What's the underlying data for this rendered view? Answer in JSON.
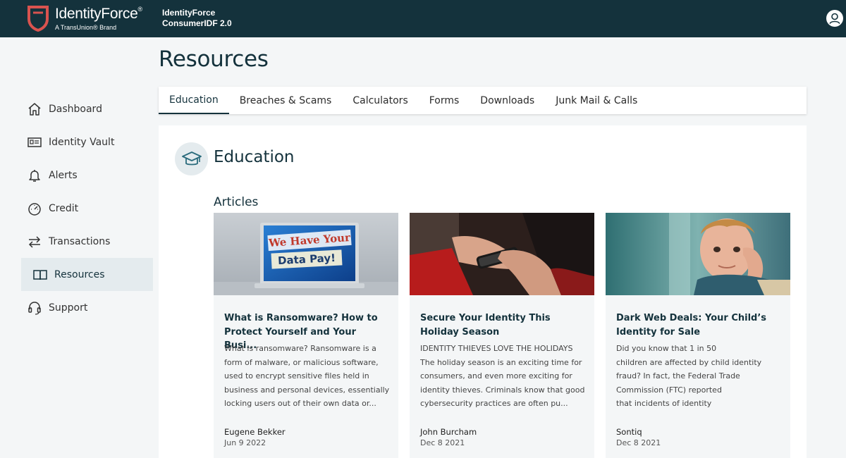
{
  "header": {
    "logo_brand": "IdentityForce",
    "logo_reg": "®",
    "logo_tagline": "A TransUnion® Brand",
    "product_line1": "IdentityForce",
    "product_line2": "ConsumerIDF 2.0",
    "brand_color": "#14323c",
    "accent_color": "#d9534f"
  },
  "sidebar": {
    "items": [
      {
        "label": "Dashboard",
        "icon": "home-icon"
      },
      {
        "label": "Identity Vault",
        "icon": "id-card-icon"
      },
      {
        "label": "Alerts",
        "icon": "bell-icon"
      },
      {
        "label": "Credit",
        "icon": "gauge-icon"
      },
      {
        "label": "Transactions",
        "icon": "arrows-icon"
      },
      {
        "label": "Resources",
        "icon": "book-icon",
        "active": true
      },
      {
        "label": "Support",
        "icon": "headset-icon"
      }
    ]
  },
  "page": {
    "title": "Resources"
  },
  "tabs": [
    {
      "label": "Education",
      "active": true
    },
    {
      "label": "Breaches & Scams"
    },
    {
      "label": "Calculators"
    },
    {
      "label": "Forms"
    },
    {
      "label": "Downloads"
    },
    {
      "label": "Junk Mail & Calls"
    }
  ],
  "section": {
    "title": "Education",
    "subtitle": "Articles"
  },
  "articles": [
    {
      "image_text_line1": "We Have Your",
      "image_text_line2": "Data Pay!",
      "title": "What is Ransomware? How to Protect Yourself and Your Busi...",
      "excerpt": "What is ransomware? Ransomware is a form of malware, or malicious software, used to encrypt sensitive files held in business and personal devices, essentially locking users out of their own data or...",
      "author": "Eugene Bekker",
      "date": "Jun 9 2022"
    },
    {
      "title": "Secure Your Identity This Holiday Season",
      "excerpt": "IDENTITY THIEVES LOVE THE HOLIDAYS\nThe holiday season is an exciting time for consumers, and even more exciting for identity thieves. Criminals know that good cybersecurity practices are often pu...",
      "author": "John Burcham",
      "date": "Dec 8 2021"
    },
    {
      "title": "Dark Web Deals: Your Child’s Identity for Sale",
      "excerpt": "Did you know that 1 in 50\nchildren are affected by child identity fraud? In fact, the Federal Trade Commission (FTC) reported\nthat incidents of identity",
      "author": "Sontiq",
      "date": "Dec 8 2021"
    }
  ]
}
